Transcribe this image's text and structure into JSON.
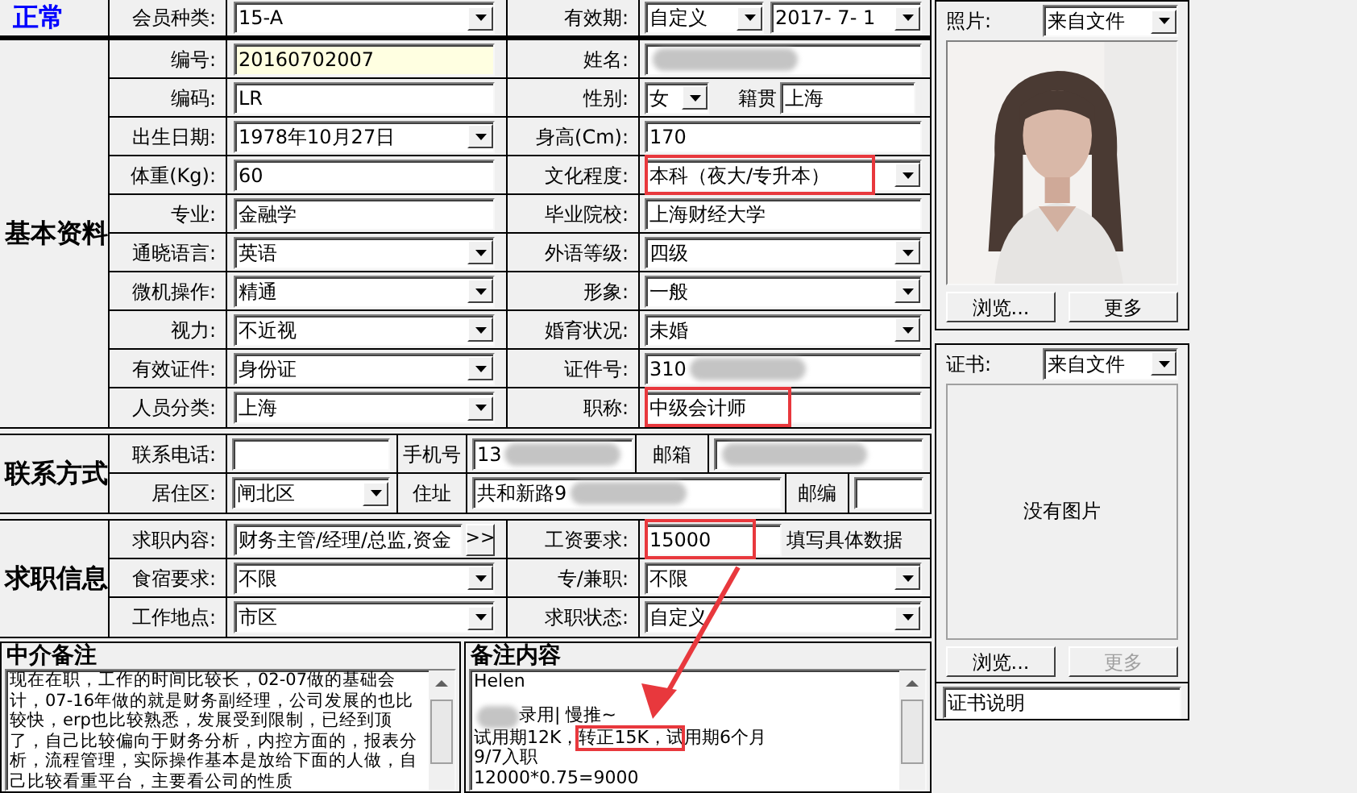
{
  "header": {
    "status": "正常",
    "member_type": {
      "label": "会员种类:",
      "value": "15-A"
    },
    "validity": {
      "label": "有效期:",
      "mode": "自定义",
      "date": "2017- 7- 1"
    }
  },
  "basic": {
    "title": "基本资料",
    "rows": [
      [
        {
          "label": "编号:",
          "kind": "id",
          "value": "20160702007"
        },
        {
          "label": "姓名:",
          "kind": "text",
          "redacted": true
        }
      ],
      [
        {
          "label": "编码:",
          "kind": "text",
          "value": "LR"
        },
        {
          "label": "性别:",
          "kind": "gender",
          "value": "女",
          "extra_label": "籍贯",
          "extra_value": "上海"
        }
      ],
      [
        {
          "label": "出生日期:",
          "kind": "select",
          "value": "1978年10月27日"
        },
        {
          "label": "身高(Cm):",
          "kind": "text",
          "value": "170"
        }
      ],
      [
        {
          "label": "体重(Kg):",
          "kind": "text",
          "value": "60"
        },
        {
          "label": "文化程度:",
          "kind": "select",
          "value": "本科（夜大/专升本）",
          "highlighted": true
        }
      ],
      [
        {
          "label": "专业:",
          "kind": "text",
          "value": "金融学"
        },
        {
          "label": "毕业院校:",
          "kind": "text",
          "value": "上海财经大学"
        }
      ],
      [
        {
          "label": "通晓语言:",
          "kind": "select",
          "value": "英语"
        },
        {
          "label": "外语等级:",
          "kind": "select",
          "value": "四级"
        }
      ],
      [
        {
          "label": "微机操作:",
          "kind": "select",
          "value": "精通"
        },
        {
          "label": "形象:",
          "kind": "select",
          "value": "一般"
        }
      ],
      [
        {
          "label": "视力:",
          "kind": "select",
          "value": "不近视"
        },
        {
          "label": "婚育状况:",
          "kind": "select",
          "value": "未婚"
        }
      ],
      [
        {
          "label": "有效证件:",
          "kind": "select",
          "value": "身份证"
        },
        {
          "label": "证件号:",
          "kind": "text",
          "value": "310",
          "redacted": true
        }
      ],
      [
        {
          "label": "人员分类:",
          "kind": "select",
          "value": "上海"
        },
        {
          "label": "职称:",
          "kind": "text",
          "value": "中级会计师",
          "highlighted": true
        }
      ]
    ]
  },
  "contact": {
    "title": "联系方式",
    "rows": [
      [
        {
          "label": "联系电话:",
          "kind": "text"
        },
        {
          "label": "手机号",
          "kind": "text",
          "value": "13",
          "redacted": true
        },
        {
          "label": "邮箱",
          "kind": "text",
          "redacted": true
        }
      ],
      [
        {
          "label": "居住区:",
          "kind": "select",
          "value": "闸北区"
        },
        {
          "label": "住址",
          "kind": "text",
          "value": "共和新路9",
          "redacted": true
        },
        {
          "label": "邮编",
          "kind": "text"
        }
      ]
    ]
  },
  "job": {
    "title": "求职信息",
    "rows": [
      [
        {
          "label": "求职内容:",
          "kind": "picker",
          "value": "财务主管/经理/总监,资金",
          "button": ">>"
        },
        {
          "label": "工资要求:",
          "kind": "text",
          "value": "15000",
          "highlighted": true,
          "hint": "填写具体数据"
        }
      ],
      [
        {
          "label": "食宿要求:",
          "kind": "select",
          "value": "不限"
        },
        {
          "label": "专/兼职:",
          "kind": "select",
          "value": "不限"
        }
      ],
      [
        {
          "label": "工作地点:",
          "kind": "select",
          "value": "市区"
        },
        {
          "label": "求职状态:",
          "kind": "select",
          "value": "自定义"
        }
      ]
    ]
  },
  "agent_notes": {
    "title": "中介备注",
    "text": "现在在职，工作的时间比较长，02-07做的基础会计，07-16年做的就是财务副经理，公司发展的也比较快，erp也比较熟悉，发展受到限制，已经到顶了，自己比较偏向于财务分析，内控方面的，报表分析，流程管理，实际操作基本是放给下面的人做，自己比较看重平台，主要看公司的性质"
  },
  "remarks": {
    "title": "备注内容",
    "lines": [
      {
        "segments": [
          {
            "text": "Helen"
          }
        ]
      },
      {
        "redacted": true,
        "segments": [
          {
            "text": "录用| 慢推~"
          }
        ]
      },
      {
        "segments": [
          {
            "text": "试用期12K，"
          },
          {
            "text": "转正15K，试",
            "highlighted": true
          },
          {
            "text": "用期6个月"
          }
        ]
      },
      {
        "segments": [
          {
            "text": "9/7入职"
          }
        ]
      },
      {
        "segments": [
          {
            "text": "12000*0.75=9000"
          }
        ]
      }
    ]
  },
  "photo": {
    "label": "照片:",
    "source": "来自文件",
    "buttons": [
      {
        "label": "浏览...",
        "disabled": false
      },
      {
        "label": "更多",
        "disabled": false
      }
    ]
  },
  "certificate": {
    "label": "证书:",
    "source": "来自文件",
    "empty_text": "没有图片",
    "buttons": [
      {
        "label": "浏览...",
        "disabled": false
      },
      {
        "label": "更多",
        "disabled": true
      }
    ],
    "description": "证书说明"
  }
}
